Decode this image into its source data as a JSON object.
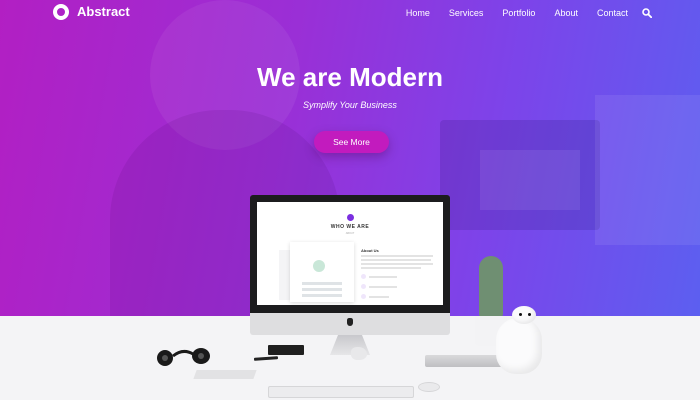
{
  "brand": {
    "name": "Abstract"
  },
  "nav": {
    "items": [
      "Home",
      "Services",
      "Portfolio",
      "About",
      "Contact"
    ],
    "search_icon": "search-icon"
  },
  "hero": {
    "title": "We are Modern",
    "subtitle": "Symplify Your Business",
    "button_label": "See More"
  },
  "screen": {
    "heading": "WHO WE ARE",
    "small": "ABOUT",
    "about_title": "About Us"
  },
  "colors": {
    "gradient_start": "#b21fc3",
    "gradient_end": "#5c5ff0",
    "button": "#c21bbe"
  }
}
